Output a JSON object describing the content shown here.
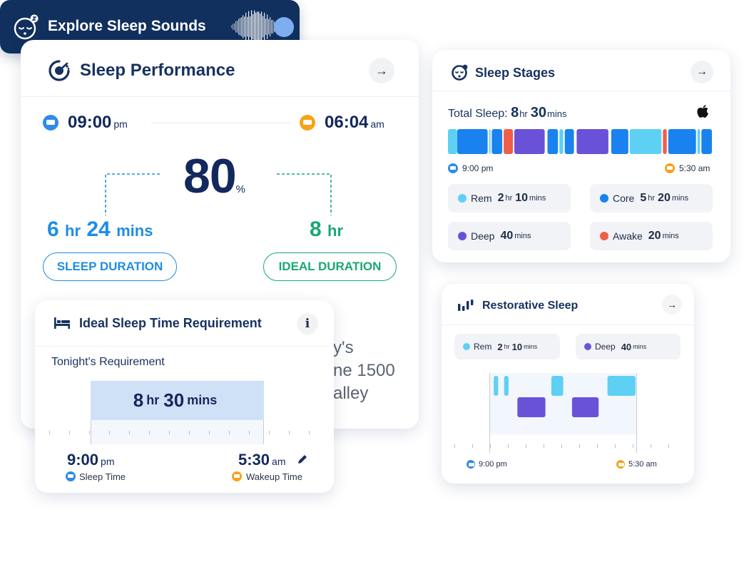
{
  "performance": {
    "title": "Sleep Performance",
    "bed_time": "09:00",
    "bed_period": "pm",
    "wake_time": "06:04",
    "wake_period": "am",
    "score": "80",
    "score_unit": "%",
    "duration_hr": "6",
    "duration_mins": "24",
    "duration_hr_unit": "hr",
    "duration_min_unit": "mins",
    "ideal_hr": "8",
    "ideal_hr_unit": "hr",
    "sleep_duration_label": "SLEEP DURATION",
    "ideal_duration_label": "IDEAL DURATION",
    "bg_text_lines": [
      "y's",
      "ne 1500",
      "alley"
    ]
  },
  "ideal": {
    "title": "Ideal Sleep Time Requirement",
    "info": "i",
    "req_label": "Tonight's Requirement",
    "req_hr": "8",
    "req_hr_unit": "hr",
    "req_mins": "30",
    "req_min_unit": "mins",
    "sleep_time": "9:00",
    "sleep_period": "pm",
    "sleep_caption": "Sleep Time",
    "wake_time": "5:30",
    "wake_period": "am",
    "wake_caption": "Wakeup Time"
  },
  "stages": {
    "title": "Sleep Stages",
    "total_label": "Total Sleep:",
    "total_hr": "8",
    "total_hr_unit": "hr",
    "total_mins": "30",
    "total_min_unit": "mins",
    "start_time": "9:00 pm",
    "end_time": "5:30 am",
    "items": [
      {
        "name": "Rem",
        "hr": "2",
        "hr_unit": "hr",
        "mins": "10",
        "min_unit": "mins",
        "color": "#5ed0f4"
      },
      {
        "name": "Core",
        "hr": "5",
        "hr_unit": "hr",
        "mins": "20",
        "min_unit": "mins",
        "color": "#1a82ee"
      },
      {
        "name": "Deep",
        "hr": "",
        "hr_unit": "",
        "mins": "40",
        "min_unit": "mins",
        "color": "#6a52d8"
      },
      {
        "name": "Awake",
        "hr": "",
        "hr_unit": "",
        "mins": "20",
        "min_unit": "mins",
        "color": "#f05e4a"
      }
    ],
    "segments": [
      {
        "stage": "rem",
        "start": 0.0,
        "end": 0.04
      },
      {
        "stage": "core",
        "start": 0.035,
        "end": 0.155
      },
      {
        "stage": "rem",
        "start": 0.155,
        "end": 0.165
      },
      {
        "stage": "core",
        "start": 0.165,
        "end": 0.21
      },
      {
        "stage": "awake",
        "start": 0.21,
        "end": 0.25
      },
      {
        "stage": "deep",
        "start": 0.25,
        "end": 0.37
      },
      {
        "stage": "core",
        "start": 0.375,
        "end": 0.42
      },
      {
        "stage": "rem",
        "start": 0.42,
        "end": 0.44
      },
      {
        "stage": "core",
        "start": 0.44,
        "end": 0.48
      },
      {
        "stage": "deep",
        "start": 0.485,
        "end": 0.61
      },
      {
        "stage": "core",
        "start": 0.615,
        "end": 0.685
      },
      {
        "stage": "rem",
        "start": 0.685,
        "end": 0.81
      },
      {
        "stage": "awake",
        "start": 0.81,
        "end": 0.83
      },
      {
        "stage": "core",
        "start": 0.83,
        "end": 0.94
      },
      {
        "stage": "rem",
        "start": 0.94,
        "end": 0.955
      },
      {
        "stage": "core",
        "start": 0.955,
        "end": 1.0
      }
    ]
  },
  "restorative": {
    "title": "Restorative Sleep",
    "rem_label": "Rem",
    "rem_hr": "2",
    "rem_hr_unit": "hr",
    "rem_mins": "10",
    "rem_min_unit": "mins",
    "deep_label": "Deep",
    "deep_mins": "40",
    "deep_min_unit": "mins",
    "start_time": "9:00 pm",
    "end_time": "5:30 am",
    "blocks": [
      {
        "stage": "rem",
        "start": 0.03,
        "end": 0.06
      },
      {
        "stage": "rem",
        "start": 0.1,
        "end": 0.13
      },
      {
        "stage": "deep",
        "start": 0.19,
        "end": 0.38
      },
      {
        "stage": "rem",
        "start": 0.42,
        "end": 0.5
      },
      {
        "stage": "deep",
        "start": 0.56,
        "end": 0.74
      },
      {
        "stage": "rem",
        "start": 0.8,
        "end": 0.99
      }
    ]
  },
  "explore": {
    "label": "Explore Sleep Sounds"
  },
  "colors": {
    "primary_text": "#13285c",
    "sleep_blue": "#1f8de6",
    "ideal_green": "#1aa873",
    "rem": "#5ed0f4",
    "core": "#1a82ee",
    "deep": "#6a52d8",
    "awake": "#f05e4a",
    "bed_icon": "#2f8be6",
    "alarm_icon": "#f7a21b",
    "button_bg": "#12305e"
  },
  "icons": {
    "performance": "sleep-gauge-icon",
    "bed": "bed-icon",
    "alarm": "alarm-clock-icon",
    "stages": "sleep-face-icon",
    "apple": "apple-logo-icon",
    "restorative": "sound-bars-icon",
    "explore": "sleeping-face-icon",
    "waveform": "waveform-icon",
    "edit": "pencil-icon",
    "arrow": "arrow-right-icon",
    "info": "info-icon"
  }
}
